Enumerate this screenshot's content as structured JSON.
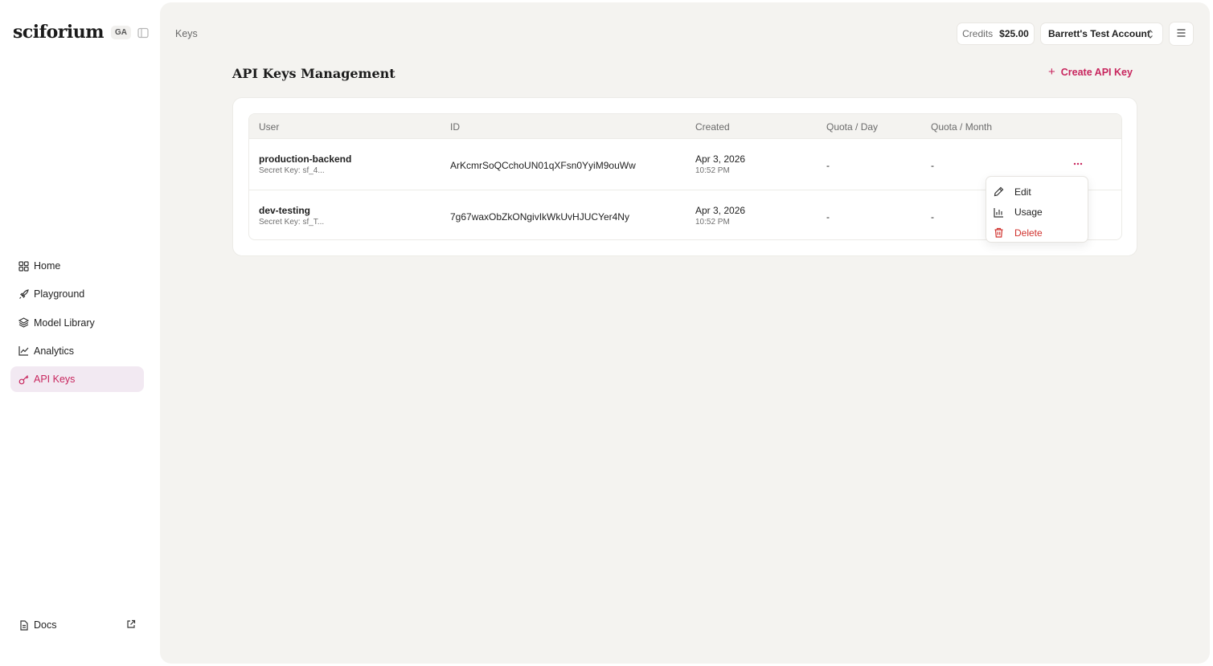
{
  "brand": {
    "logo": "sciforium",
    "badge": "GA"
  },
  "sidebar": {
    "items": [
      {
        "label": "Home",
        "icon": "grid-icon"
      },
      {
        "label": "Playground",
        "icon": "rocket-icon"
      },
      {
        "label": "Model Library",
        "icon": "layers-icon"
      },
      {
        "label": "Analytics",
        "icon": "line-chart-icon"
      },
      {
        "label": "API Keys",
        "icon": "key-icon",
        "active": true
      }
    ],
    "docs": {
      "label": "Docs",
      "icon": "document-icon"
    }
  },
  "header": {
    "breadcrumb": "Keys",
    "credits_label": "Credits",
    "credits_value": "$25.00",
    "account": "Barrett's Test Account"
  },
  "main": {
    "title": "API Keys Management",
    "create_button": "Create API Key"
  },
  "table": {
    "columns": [
      "User",
      "ID",
      "Created",
      "Quota / Day",
      "Quota / Month"
    ],
    "rows": [
      {
        "name": "production-backend",
        "secret": "Secret Key: sf_4...",
        "id": "ArKcmrSoQCchoUN01qXFsn0YyiM9ouWw",
        "date": "Apr 3, 2026",
        "time": "10:52 PM",
        "quota_day": "-",
        "quota_month": "-"
      },
      {
        "name": "dev-testing",
        "secret": "Secret Key: sf_T...",
        "id": "7g67waxObZkONgivIkWkUvHJUCYer4Ny",
        "date": "Apr 3, 2026",
        "time": "10:52 PM",
        "quota_day": "-",
        "quota_month": "-"
      }
    ]
  },
  "row_menu": {
    "items": [
      {
        "label": "Edit",
        "icon": "pencil-icon"
      },
      {
        "label": "Usage",
        "icon": "bar-chart-icon"
      },
      {
        "label": "Delete",
        "icon": "trash-icon"
      }
    ]
  },
  "colors": {
    "accent": "#c8265e",
    "danger": "#d0312d",
    "panel": "#f4f3f0",
    "active_bg": "#f2e9f2"
  }
}
